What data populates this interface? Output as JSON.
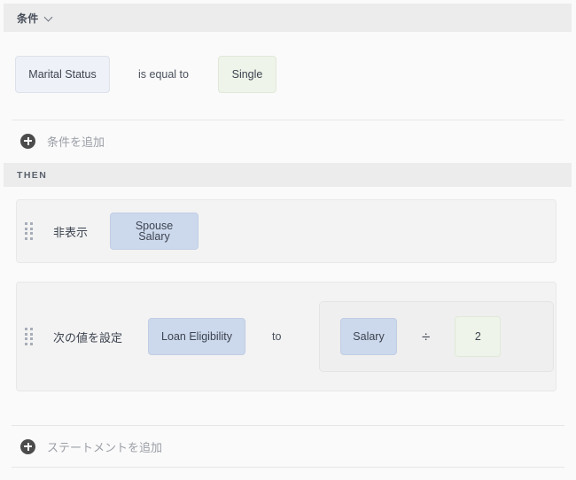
{
  "window": {
    "background": "#fafafa"
  },
  "if_section": {
    "title": "条件",
    "chevron_icon": "chevron-down-icon",
    "condition": {
      "field_label": "Marital Status",
      "operator_label": "is equal to",
      "value_label": "Single"
    },
    "add_condition": {
      "icon": "plus-circle-icon",
      "label": "条件を追加"
    }
  },
  "then_section": {
    "title": "THEN",
    "statements": [
      {
        "drag_handle_icon": "drag-handle-icon",
        "action_label": "非表示",
        "target_label": "Spouse Salary"
      },
      {
        "drag_handle_icon": "drag-handle-icon",
        "action_label": "次の値を設定",
        "target_label": "Loan Eligibility",
        "connector_label": "to",
        "formula": {
          "operand_label": "Salary",
          "operator_symbol": "÷",
          "value_label": "2"
        }
      }
    ],
    "add_statement": {
      "icon": "plus-circle-icon",
      "label": "ステートメントを追加"
    }
  },
  "colors": {
    "section_bar": "#ececec",
    "page_background": "#fafafa",
    "card_background": "#f3f3f3",
    "field_chip": "#eef1f7",
    "field_chip_solid": "#ccd8ec",
    "value_chip": "#eef4e9",
    "text": "#3d4450",
    "muted_text": "#9b9fa6"
  }
}
